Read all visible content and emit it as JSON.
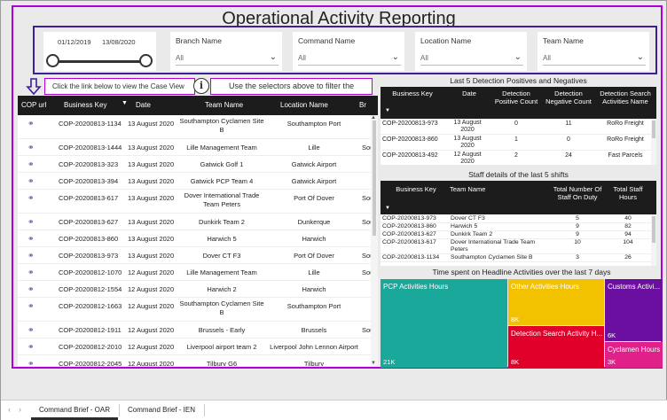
{
  "title": "Operational Activity Reporting",
  "date_slicer": {
    "start": "01/12/2019",
    "end": "13/08/2020"
  },
  "slicers": [
    {
      "label": "Branch Name",
      "value": "All"
    },
    {
      "label": "Command Name",
      "value": "All"
    },
    {
      "label": "Location Name",
      "value": "All"
    },
    {
      "label": "Team Name",
      "value": "All"
    }
  ],
  "hints": {
    "case_view": "Click the link below to view the Case View",
    "filter": "Use the selectors above to filter the data"
  },
  "case_table": {
    "columns": [
      "COP url",
      "Business Key",
      "Date",
      "Team Name",
      "Location Name",
      "Br"
    ],
    "rows": [
      {
        "key": "COP-20200813-1134",
        "date": "13 August 2020",
        "team": "Southampton Cyclamen Site B",
        "location": "Southampton Port",
        "branch": ""
      },
      {
        "key": "COP-20200813-1444",
        "date": "13 August 2020",
        "team": "Lille Management Team",
        "location": "Lille",
        "branch": "South"
      },
      {
        "key": "COP-20200813-323",
        "date": "13 August 2020",
        "team": "Gatwick Golf 1",
        "location": "Gatwick Airport",
        "branch": ""
      },
      {
        "key": "COP-20200813-394",
        "date": "13 August 2020",
        "team": "Gatwick PCP Team 4",
        "location": "Gatwick Airport",
        "branch": ""
      },
      {
        "key": "COP-20200813-617",
        "date": "13 August 2020",
        "team": "Dover International Trade Team Peters",
        "location": "Port Of Dover",
        "branch": "South"
      },
      {
        "key": "COP-20200813-627",
        "date": "13 August 2020",
        "team": "Dunkirk Team 2",
        "location": "Dunkerque",
        "branch": "South"
      },
      {
        "key": "COP-20200813-860",
        "date": "13 August 2020",
        "team": "Harwich 5",
        "location": "Harwich",
        "branch": ""
      },
      {
        "key": "COP-20200813-973",
        "date": "13 August 2020",
        "team": "Dover CT F3",
        "location": "Port Of Dover",
        "branch": "South"
      },
      {
        "key": "COP-20200812-1070",
        "date": "12 August 2020",
        "team": "Lille Management Team",
        "location": "Lille",
        "branch": "South"
      },
      {
        "key": "COP-20200812-1554",
        "date": "12 August 2020",
        "team": "Harwich 2",
        "location": "Harwich",
        "branch": ""
      },
      {
        "key": "COP-20200812-1663",
        "date": "12 August 2020",
        "team": "Southampton Cyclamen Site B",
        "location": "Southampton Port",
        "branch": ""
      },
      {
        "key": "COP-20200812-1911",
        "date": "12 August 2020",
        "team": "Brussels - Early",
        "location": "Brussels",
        "branch": "South"
      },
      {
        "key": "COP-20200812-2010",
        "date": "12 August 2020",
        "team": "Liverpool airport team 2",
        "location": "Liverpool John Lennon Airport",
        "branch": ""
      },
      {
        "key": "COP-20200812-2045",
        "date": "12 August 2020",
        "team": "Tilbury G6",
        "location": "Tilbury",
        "branch": ""
      }
    ]
  },
  "detection": {
    "title": "Last 5 Detection Positives and Negatives",
    "columns": [
      "Business Key",
      "Date",
      "Detection Positive Count",
      "Detection Negative Count",
      "Detection Search Activities Name"
    ],
    "rows": [
      {
        "key": "COP-20200813-973",
        "date": "13 August 2020",
        "pos": "0",
        "neg": "11",
        "name": "RoRo Freight"
      },
      {
        "key": "COP-20200813-860",
        "date": "13 August 2020",
        "pos": "1",
        "neg": "0",
        "name": "RoRo Freight"
      },
      {
        "key": "COP-20200813-492",
        "date": "12 August 2020",
        "pos": "2",
        "neg": "24",
        "name": "Fast Parcels"
      }
    ]
  },
  "staff": {
    "title": "Staff details of the last 5 shifts",
    "columns": [
      "Business Key",
      "Team Name",
      "Total Number Of Staff On Duty",
      "Total Staff Hours"
    ],
    "rows": [
      {
        "key": "COP-20200813-973",
        "team": "Dover CT F3",
        "staff": "5",
        "hours": "40"
      },
      {
        "key": "COP-20200813-860",
        "team": "Harwich 5",
        "staff": "9",
        "hours": "82"
      },
      {
        "key": "COP-20200813-627",
        "team": "Dunkirk Team 2",
        "staff": "9",
        "hours": "94"
      },
      {
        "key": "COP-20200813-617",
        "team": "Dover International Trade Team Peters",
        "staff": "10",
        "hours": "104"
      },
      {
        "key": "COP-20200813-1134",
        "team": "Southampton Cyclamen Site B",
        "staff": "3",
        "hours": "26"
      }
    ]
  },
  "treemap": {
    "title": "Time spent on Headline Activities over the last 7 days",
    "items": [
      {
        "name": "PCP Activities Hours",
        "value": "21K",
        "color": "#1aa89a"
      },
      {
        "name": "Other Activities Hours",
        "value": "8K",
        "color": "#f2c200"
      },
      {
        "name": "Detection Search Activity H...",
        "value": "8K",
        "color": "#e0002a"
      },
      {
        "name": "Customs Activi...",
        "value": "6K",
        "color": "#6a0fa0"
      },
      {
        "name": "Cyclamen Hours",
        "value": "3K",
        "color": "#e0218a"
      }
    ]
  },
  "tabs": [
    "Command Brief - OAR",
    "Command Brief - IEN"
  ],
  "colors": {
    "accent_border": "#b000d8",
    "slicer_border": "#3d1f98",
    "header_bg": "#1c1c1c"
  }
}
